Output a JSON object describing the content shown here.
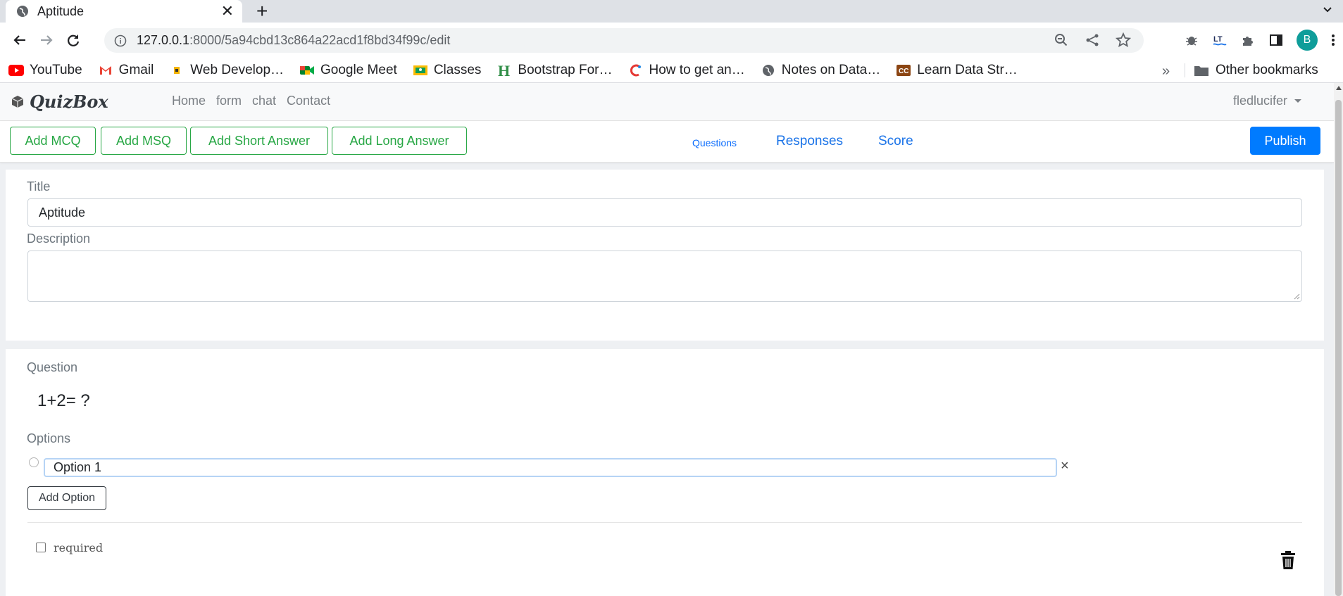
{
  "browser": {
    "tab_title": "Aptitude",
    "url_host": "127.0.0.1",
    "url_rest": ":8000/5a94cbd13c864a22acd1f8bd34f99c/edit",
    "avatar_letter": "B",
    "bookmarks": [
      {
        "label": "YouTube",
        "icon": "youtube-icon"
      },
      {
        "label": "Gmail",
        "icon": "gmail-icon"
      },
      {
        "label": "Web Develop…",
        "icon": "web-dev-icon"
      },
      {
        "label": "Google Meet",
        "icon": "meet-icon"
      },
      {
        "label": "Classes",
        "icon": "classroom-icon"
      },
      {
        "label": "Bootstrap For…",
        "icon": "bootstrap-h-icon"
      },
      {
        "label": "How to get an…",
        "icon": "how-to-icon"
      },
      {
        "label": "Notes on Data…",
        "icon": "globe-icon"
      },
      {
        "label": "Learn Data Str…",
        "icon": "cc-icon"
      }
    ],
    "bookmarks_more": "»",
    "other_bookmarks": "Other bookmarks"
  },
  "app": {
    "brand": "QuizBox",
    "nav": [
      "Home",
      "form",
      "chat",
      "Contact"
    ],
    "user": "fledlucifer"
  },
  "actions": {
    "add_mcq": "Add MCQ",
    "add_msq": "Add MSQ",
    "add_short": "Add Short Answer",
    "add_long": "Add Long Answer",
    "tab_questions": "Questions",
    "tab_responses": "Responses",
    "tab_score": "Score",
    "publish": "Publish"
  },
  "form": {
    "title_label": "Title",
    "title_value": "Aptitude",
    "description_label": "Description",
    "description_value": ""
  },
  "question": {
    "label": "Question",
    "text": "1+2= ?",
    "options_label": "Options",
    "options": [
      "Option 1"
    ],
    "remove_symbol": "×",
    "add_option": "Add Option",
    "required_label": "required"
  },
  "colors": {
    "accent_green": "#28a745",
    "primary_blue": "#007bff",
    "link_blue": "#1a73e8"
  }
}
